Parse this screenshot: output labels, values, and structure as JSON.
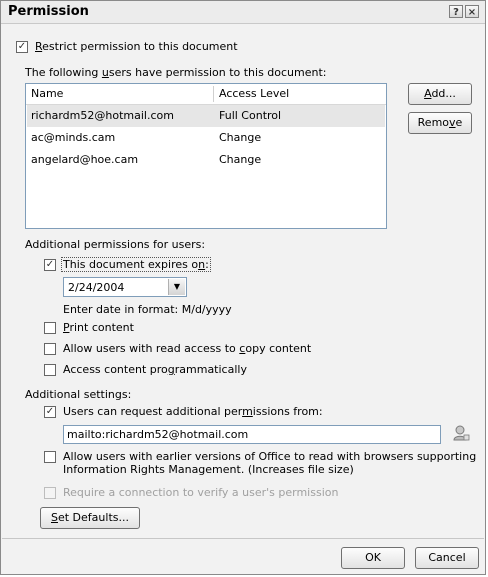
{
  "window": {
    "title": "Permission",
    "help_button": "?",
    "close_button": "×"
  },
  "restrict": {
    "label_pre": "",
    "label_accel": "R",
    "label_post": "estrict permission to this document",
    "checked": true
  },
  "users": {
    "heading_pre": "The following ",
    "heading_accel": "u",
    "heading_post": "sers have permission to this document:",
    "columns": [
      "Name",
      "Access Level"
    ],
    "rows": [
      {
        "name": "richardm52@hotmail.com",
        "access": "Full Control",
        "selected": true
      },
      {
        "name": "ac@minds.cam",
        "access": "Change",
        "selected": false
      },
      {
        "name": "angelard@hoe.cam",
        "access": "Change",
        "selected": false
      }
    ],
    "add_button": {
      "pre": "",
      "accel": "A",
      "post": "dd..."
    },
    "remove_button": {
      "pre": "Remo",
      "accel": "v",
      "post": "e"
    }
  },
  "additional_permissions": {
    "heading": "Additional permissions for users:",
    "expires": {
      "pre": "This document expires o",
      "accel": "n",
      "post": ":",
      "checked": true
    },
    "expiry_date": "2/24/2004",
    "date_hint": "Enter date in format: M/d/yyyy",
    "print": {
      "pre": "",
      "accel": "P",
      "post": "rint content",
      "checked": false
    },
    "copy": {
      "pre": "Allow users with read access to ",
      "accel": "c",
      "post": "opy content",
      "checked": false
    },
    "programmatic": {
      "pre": "Access content pro",
      "accel": "g",
      "post": "rammatically",
      "checked": false
    }
  },
  "additional_settings": {
    "heading": "Additional settings:",
    "request": {
      "pre": "Users can request additional per",
      "accel": "m",
      "post": "issions from:",
      "checked": true
    },
    "request_value": "mailto:richardm52@hotmail.com",
    "older_versions": {
      "line1": "Allow users with earlier versions of Office to read with browsers supporting",
      "line2": "Information Rights Management. (Increases file size)",
      "checked": false
    },
    "require_connection": {
      "label": "Require a connection to verify a user's permission",
      "checked": false,
      "enabled": false
    },
    "set_defaults": {
      "pre": "",
      "accel": "S",
      "post": "et Defaults..."
    }
  },
  "footer": {
    "ok": "OK",
    "cancel": "Cancel"
  },
  "icons": {
    "check_glyph": "✓",
    "dropdown_glyph": "▼"
  }
}
